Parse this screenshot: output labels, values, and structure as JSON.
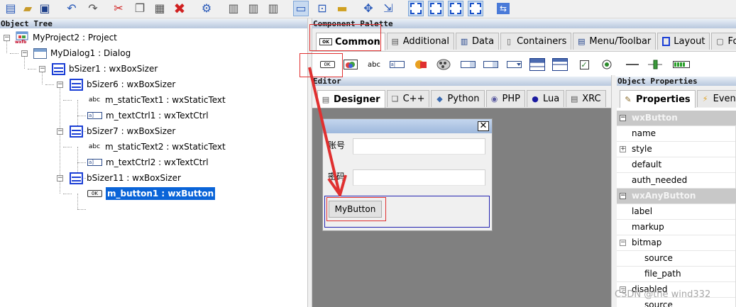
{
  "toolbar": {
    "icons": [
      "new-project-icon",
      "open-icon",
      "save-icon",
      "undo-icon",
      "redo-icon",
      "cut-icon",
      "copy-icon",
      "paste-icon",
      "delete-icon",
      "settings-icon",
      "align-left-icon",
      "align-center-icon",
      "align-right-icon",
      "expand-icon",
      "align-top-icon",
      "align-bottom-icon",
      "fit-icon",
      "border-left-icon",
      "border-right-icon",
      "border-top-icon",
      "border-bottom-icon",
      "swap-icon"
    ]
  },
  "object_tree": {
    "title": "Object Tree",
    "nodes": [
      {
        "label": "MyProject2 : Project",
        "icon": "project-icon"
      },
      {
        "label": "MyDialog1 : Dialog",
        "icon": "dialog-icon"
      },
      {
        "label": "bSizer1 : wxBoxSizer",
        "icon": "box-sizer-icon"
      },
      {
        "label": "bSizer6 : wxBoxSizer",
        "icon": "box-sizer-icon"
      },
      {
        "label": "m_staticText1 : wxStaticText",
        "icon": "static-text-icon"
      },
      {
        "label": "m_textCtrl1 : wxTextCtrl",
        "icon": "text-ctrl-icon"
      },
      {
        "label": "bSizer7 : wxBoxSizer",
        "icon": "box-sizer-icon"
      },
      {
        "label": "m_staticText2 : wxStaticText",
        "icon": "static-text-icon"
      },
      {
        "label": "m_textCtrl2 : wxTextCtrl",
        "icon": "text-ctrl-icon"
      },
      {
        "label": "bSizer11 : wxBoxSizer",
        "icon": "box-sizer-icon"
      },
      {
        "label": "m_button1 : wxButton",
        "icon": "button-icon",
        "selected": true
      }
    ],
    "icon_text": {
      "abc": "abc",
      "text_ctrl": "a]",
      "button": "0K",
      "project_badge": "wxfb"
    }
  },
  "palette": {
    "title": "Component Palette",
    "tabs": [
      "Common",
      "Additional",
      "Data",
      "Containers",
      "Menu/Toolbar",
      "Layout",
      "Fo"
    ],
    "active_tab": "Common",
    "items": [
      "button-icon",
      "bitmap-button-icon",
      "static-text-icon",
      "text-ctrl-icon",
      "static-bitmap-icon",
      "combo-box-icon",
      "choice-icon",
      "list-box-icon",
      "list-ctrl-icon",
      "checklist-icon",
      "check-box-icon",
      "radio-button-icon",
      "static-line-icon",
      "slider-icon",
      "gauge-icon"
    ],
    "item_text": {
      "button": "0K",
      "static_text": "abc",
      "field": "a|"
    }
  },
  "editor": {
    "title": "Editor",
    "tabs": [
      "Designer",
      "C++",
      "Python",
      "PHP",
      "Lua",
      "XRC"
    ],
    "active_tab": "Designer",
    "dialog": {
      "close_glyph": "✕",
      "label1": "账号",
      "label2": "密码",
      "button_label": "MyButton"
    }
  },
  "properties": {
    "title": "Object Properties",
    "tabs": [
      "Properties",
      "Events"
    ],
    "active_tab": "Properties",
    "rows": [
      {
        "text": "wxButton",
        "kind": "category",
        "expander": "−"
      },
      {
        "text": "name",
        "kind": "prop"
      },
      {
        "text": "style",
        "kind": "prop",
        "expander": "+"
      },
      {
        "text": "default",
        "kind": "prop"
      },
      {
        "text": "auth_needed",
        "kind": "prop"
      },
      {
        "text": "wxAnyButton",
        "kind": "category",
        "expander": "−"
      },
      {
        "text": "label",
        "kind": "prop"
      },
      {
        "text": "markup",
        "kind": "prop"
      },
      {
        "text": "bitmap",
        "kind": "prop",
        "expander": "−"
      },
      {
        "text": "source",
        "kind": "sub"
      },
      {
        "text": "file_path",
        "kind": "sub"
      },
      {
        "text": "disabled",
        "kind": "prop",
        "expander": "−"
      },
      {
        "text": "source",
        "kind": "sub"
      }
    ]
  },
  "watermark": "CSDN @the wind332",
  "colors": {
    "annotation": "#e03030",
    "selection": "#0a64d8",
    "sizer": "#1b3fd6"
  }
}
